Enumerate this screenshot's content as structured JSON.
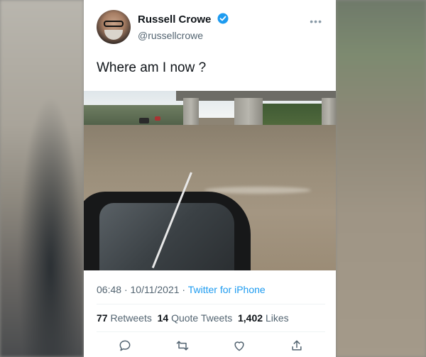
{
  "author": {
    "display_name": "Russell Crowe",
    "handle": "@russellcrowe",
    "verified": true
  },
  "tweet": {
    "text": "Where am I now ?",
    "time": "06:48",
    "date": "10/11/2021",
    "source": "Twitter for iPhone"
  },
  "stats": {
    "retweets_count": "77",
    "retweets_label": "Retweets",
    "quote_count": "14",
    "quote_label": "Quote Tweets",
    "likes_count": "1,402",
    "likes_label": "Likes"
  },
  "colors": {
    "accent": "#1d9bf0",
    "text_primary": "#0f1419",
    "text_secondary": "#536471"
  },
  "icons": [
    "verified-badge-icon",
    "more-icon",
    "reply-icon",
    "retweet-icon",
    "like-icon",
    "share-icon"
  ]
}
